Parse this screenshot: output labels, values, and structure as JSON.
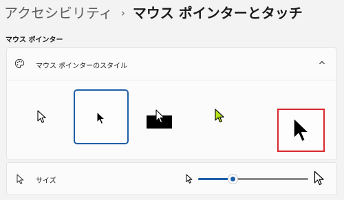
{
  "breadcrumb": {
    "parent": "アクセシビリティ",
    "separator": "›",
    "current": "マウス ポインターとタッチ"
  },
  "section": {
    "title": "マウス ポインター"
  },
  "pointer_style": {
    "label": "マウス ポインターのスタイル",
    "expanded": true,
    "options": [
      {
        "name": "white",
        "icon": "white-arrow-cursor-icon",
        "selected": false
      },
      {
        "name": "black",
        "icon": "black-arrow-cursor-icon",
        "selected": true
      },
      {
        "name": "inverted",
        "icon": "inverted-arrow-cursor-icon",
        "selected": false
      },
      {
        "name": "custom",
        "icon": "lime-arrow-cursor-icon",
        "selected": false,
        "color": "#b7e21a"
      },
      {
        "name": "large-black",
        "icon": "large-black-arrow-cursor-icon",
        "selected": false,
        "highlighted": true,
        "highlight_color": "#d9262c"
      }
    ]
  },
  "size": {
    "label": "サイズ",
    "value_fraction": 0.31
  },
  "colors": {
    "accent": "#1f5fa8",
    "highlight": "#d9262c",
    "custom_cursor": "#b7e21a"
  }
}
